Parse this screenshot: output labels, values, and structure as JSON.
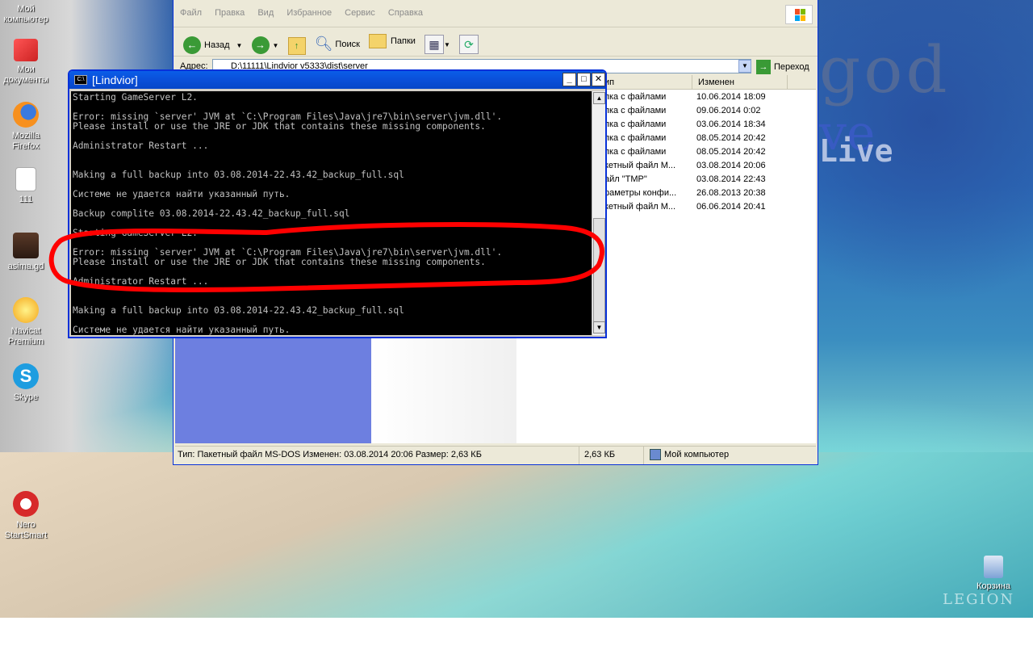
{
  "desktop": {
    "icons": [
      {
        "label": "Мой компьютер",
        "icon": "my-computer-icon"
      },
      {
        "label": "Мои документы",
        "icon": "my-documents-icon"
      },
      {
        "label": "Mozilla Firefox",
        "icon": "firefox-icon"
      },
      {
        "label": "111",
        "icon": "file-icon"
      },
      {
        "label": "asima.gd",
        "icon": "lineage-icon"
      },
      {
        "label": "Navicat Premium",
        "icon": "navicat-icon"
      },
      {
        "label": "Skype",
        "icon": "skype-icon"
      },
      {
        "label": "Nero StartSmart",
        "icon": "nero-icon"
      },
      {
        "label": "Корзина",
        "icon": "recycle-bin-icon"
      }
    ],
    "wallpaper_text": [
      "god",
      "ve",
      "Live",
      "LEGION"
    ]
  },
  "explorer": {
    "menu": [
      "Файл",
      "Правка",
      "Вид",
      "Избранное",
      "Сервис",
      "Справка"
    ],
    "toolbar": {
      "back": "Назад",
      "search": "Поиск",
      "folders": "Папки"
    },
    "address": {
      "label": "Адрес:",
      "path": "D:\\11111\\Lindvior v5333\\dist\\server",
      "go": "Переход"
    },
    "columns": {
      "type": "ип",
      "modified": "Изменен"
    },
    "files": [
      {
        "type": "пка с файлами",
        "modified": "10.06.2014 18:09"
      },
      {
        "type": "пка с файлами",
        "modified": "09.06.2014 0:02"
      },
      {
        "type": "пка с файлами",
        "modified": "03.06.2014 18:34"
      },
      {
        "type": "пка с файлами",
        "modified": "08.05.2014 20:42"
      },
      {
        "type": "пка с файлами",
        "modified": "08.05.2014 20:42"
      },
      {
        "type": "кетный файл M...",
        "modified": "03.08.2014 20:06"
      },
      {
        "type": "айл \"TMP\"",
        "modified": "03.08.2014 22:43"
      },
      {
        "type": "раметры конфи...",
        "modified": "26.08.2013 20:38"
      },
      {
        "type": "кетный файл M...",
        "modified": "06.06.2014 20:41"
      }
    ],
    "status": {
      "info": "Тип: Пакетный файл MS-DOS Изменен: 03.08.2014 20:06 Размер: 2,63 КБ",
      "size": "2,63 КБ",
      "location": "Мой компьютер"
    }
  },
  "console": {
    "title": "[Lindvior]",
    "lines": [
      "Starting GameServer L2.",
      "",
      "Error: missing `server' JVM at `C:\\Program Files\\Java\\jre7\\bin\\server\\jvm.dll'.",
      "Please install or use the JRE or JDK that contains these missing components.",
      "",
      "Administrator Restart ...",
      "",
      "",
      "Making a full backup into 03.08.2014-22.43.42_backup_full.sql",
      "",
      "Системе не удается найти указанный путь.",
      "",
      "Backup complite 03.08.2014-22.43.42_backup_full.sql",
      "",
      "Starting GameServer L2.",
      "",
      "Error: missing `server' JVM at `C:\\Program Files\\Java\\jre7\\bin\\server\\jvm.dll'.",
      "Please install or use the JRE or JDK that contains these missing components.",
      "",
      "Administrator Restart ...",
      "",
      "",
      "Making a full backup into 03.08.2014-22.43.42_backup_full.sql",
      "",
      "Системе не удается найти указанный путь."
    ]
  },
  "colors": {
    "annotation": "#ff0000",
    "titlebar": "#0a5ee8",
    "console_bg": "#000000"
  }
}
